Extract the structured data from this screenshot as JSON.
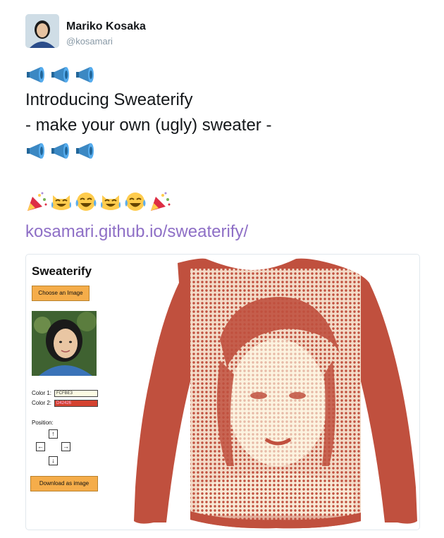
{
  "author": {
    "name": "Mariko Kosaka",
    "handle": "@kosamari"
  },
  "tweet": {
    "line1": "Introducing Sweaterify",
    "line2": "- make your own (ugly) sweater -",
    "link": "kosamari.github.io/sweaterify/",
    "emoji_row1": [
      "megaphone-icon",
      "megaphone-icon",
      "megaphone-icon"
    ],
    "emoji_row2": [
      "megaphone-icon",
      "megaphone-icon",
      "megaphone-icon"
    ],
    "emoji_row3": [
      "party-popper-icon",
      "cat-tears-of-joy-icon",
      "face-tears-of-joy-icon",
      "cat-tears-of-joy-icon",
      "face-tears-of-joy-icon",
      "party-popper-icon"
    ]
  },
  "app": {
    "title": "Sweaterify",
    "choose_image_label": "Choose an Image",
    "color1_label": "Color 1:",
    "color1_value": "FCFBE3",
    "color2_label": "Color 2:",
    "color2_value": "D42426",
    "position_label": "Position:",
    "arrow_up": "↑",
    "arrow_left": "←",
    "arrow_right": "→",
    "arrow_down": "↓",
    "download_label": "Download as image"
  },
  "colors": {
    "sweater_dark": "#c0503e",
    "sweater_light": "#fcf3e0",
    "color1_swatch": "#fcfbe3",
    "color2_swatch": "#d44230",
    "button_yellow": "#f5ad4a",
    "link": "#8e6fc6"
  }
}
